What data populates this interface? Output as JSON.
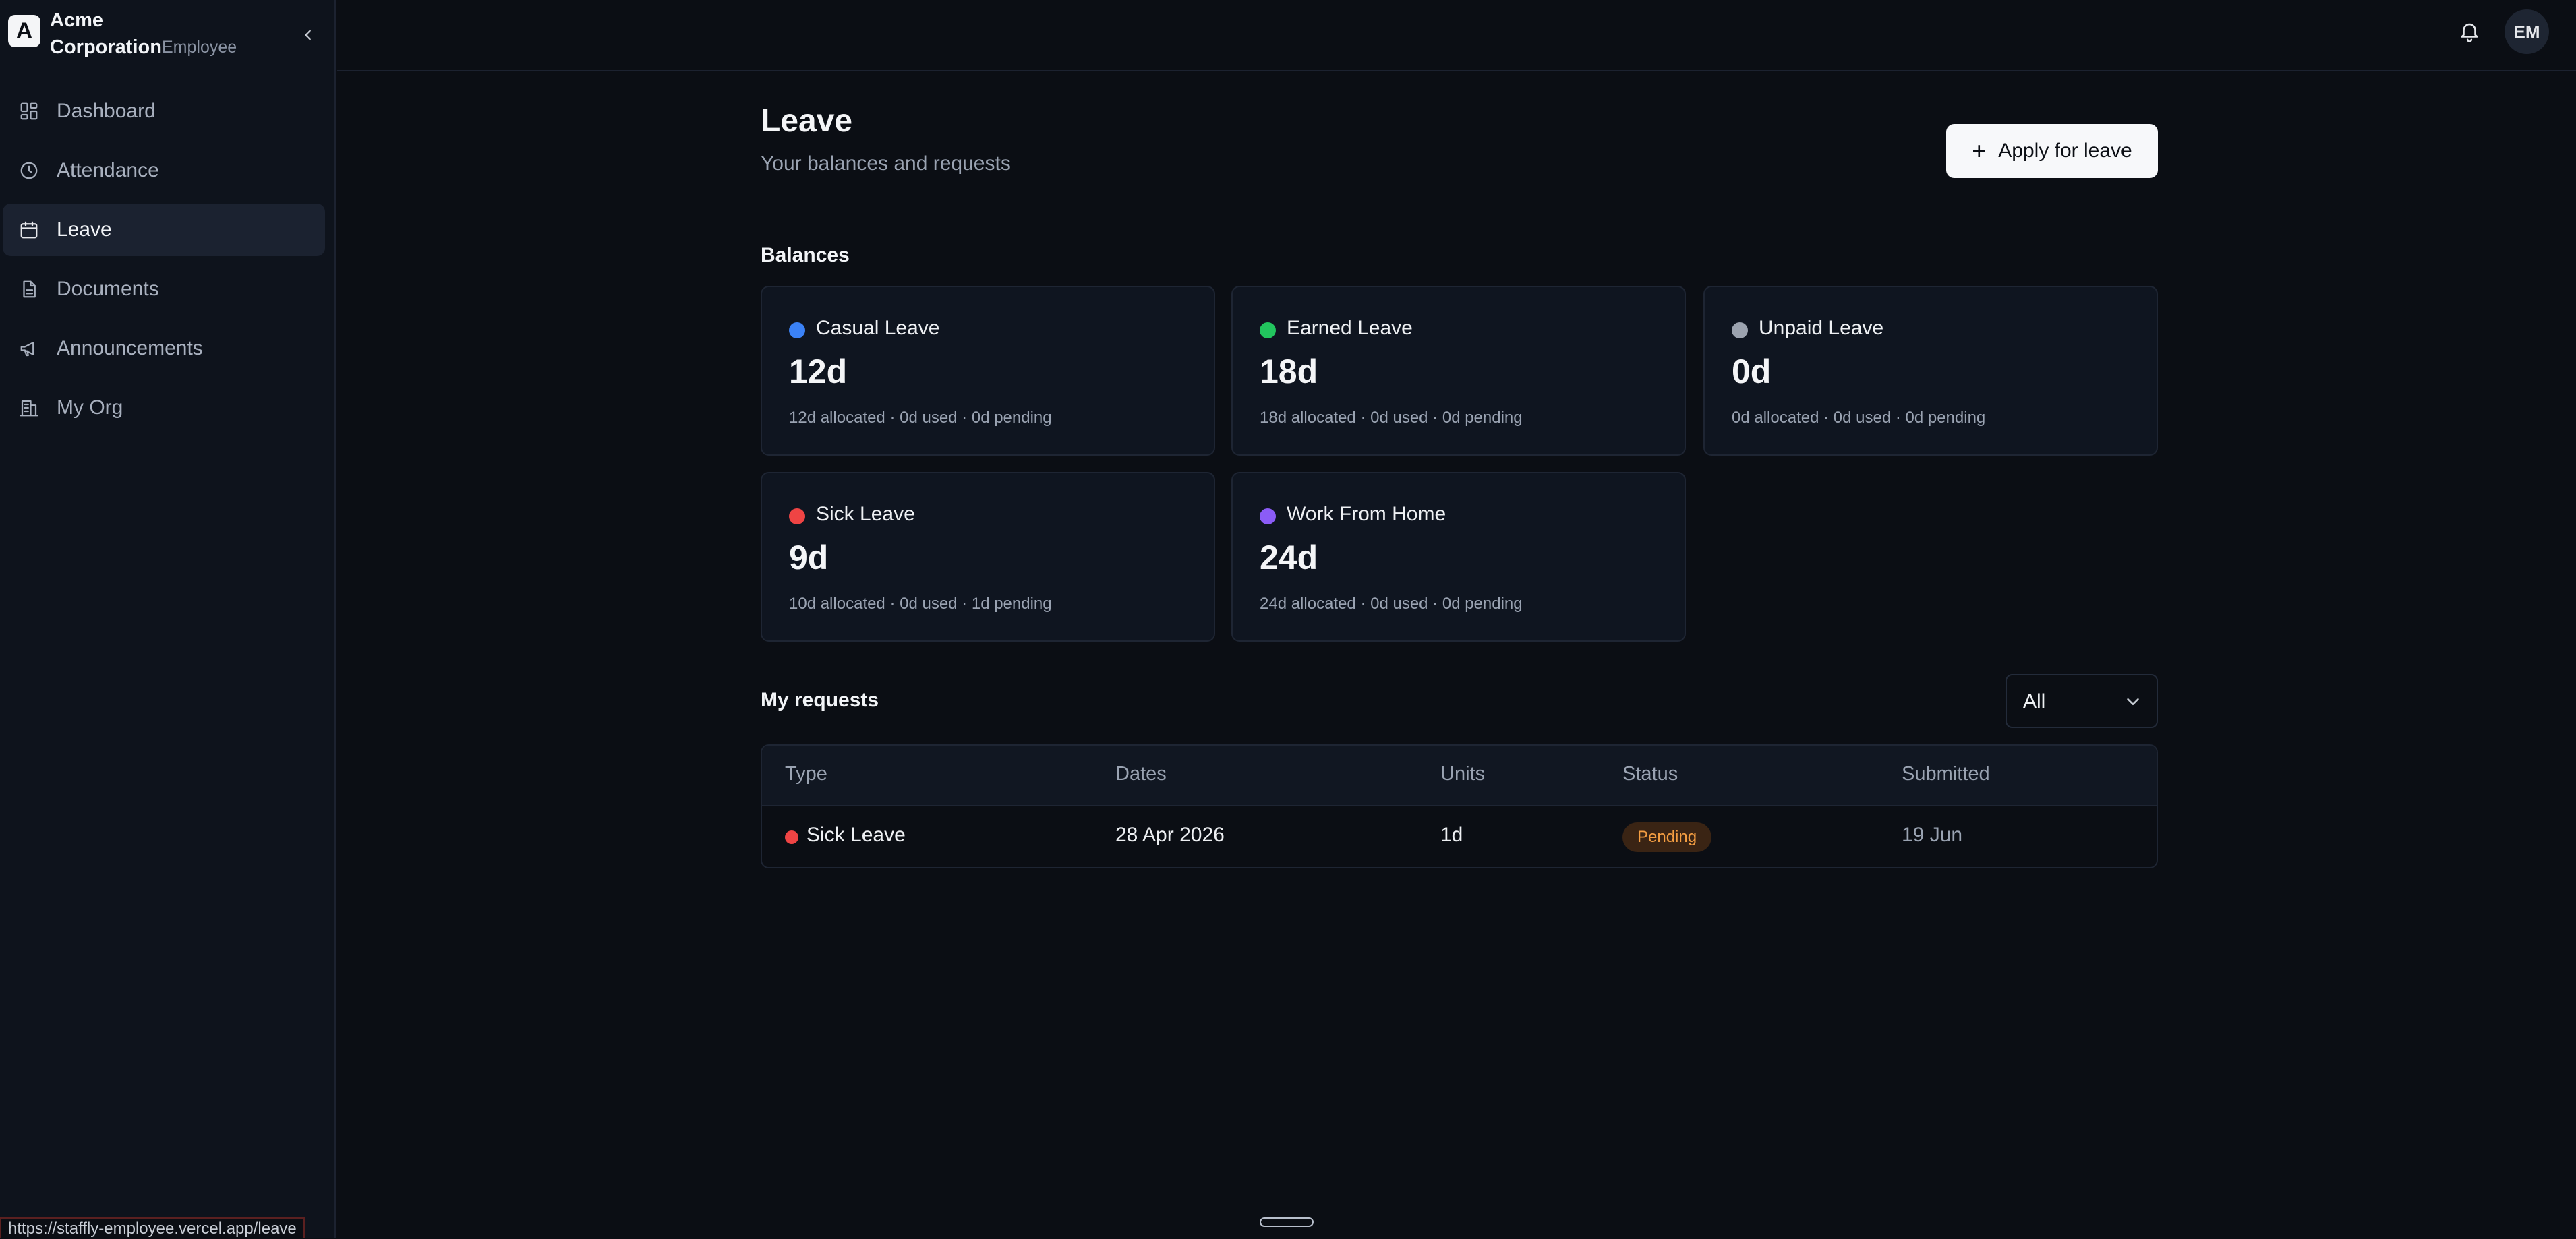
{
  "app": {
    "brand_initial": "A",
    "brand_name_line1": "Acme",
    "brand_name_line2": "Corporation",
    "role": "Employee",
    "user_initials": "EM",
    "status_url": "https://staffly-employee.vercel.app/leave"
  },
  "sidebar": {
    "items": [
      {
        "label": "Dashboard",
        "icon": "dashboard-icon"
      },
      {
        "label": "Attendance",
        "icon": "clock-icon"
      },
      {
        "label": "Leave",
        "icon": "calendar-icon"
      },
      {
        "label": "Documents",
        "icon": "document-icon"
      },
      {
        "label": "Announcements",
        "icon": "megaphone-icon"
      },
      {
        "label": "My Org",
        "icon": "building-icon"
      }
    ]
  },
  "page": {
    "title": "Leave",
    "subtitle": "Your balances and requests",
    "apply_label": "Apply for leave",
    "balances_title": "Balances",
    "requests_title": "My requests",
    "filter_value": "All"
  },
  "balances": [
    {
      "name": "Casual Leave",
      "value": "12d",
      "meta": "12d allocated · 0d used · 0d pending",
      "color": "#3b82f6"
    },
    {
      "name": "Earned Leave",
      "value": "18d",
      "meta": "18d allocated · 0d used · 0d pending",
      "color": "#22c55e"
    },
    {
      "name": "Unpaid Leave",
      "value": "0d",
      "meta": "0d allocated · 0d used · 0d pending",
      "color": "#9ca3af"
    },
    {
      "name": "Sick Leave",
      "value": "9d",
      "meta": "10d allocated · 0d used · 1d pending",
      "color": "#ef4444"
    },
    {
      "name": "Work From Home",
      "value": "24d",
      "meta": "24d allocated · 0d used · 0d pending",
      "color": "#8b5cf6"
    }
  ],
  "table": {
    "headers": [
      "Type",
      "Dates",
      "Units",
      "Status",
      "Submitted"
    ],
    "rows": [
      {
        "type": "Sick Leave",
        "dates": "28 Apr 2026",
        "units": "1d",
        "status": "Pending",
        "submitted": "19 Jun",
        "color": "#ef4444"
      }
    ]
  }
}
